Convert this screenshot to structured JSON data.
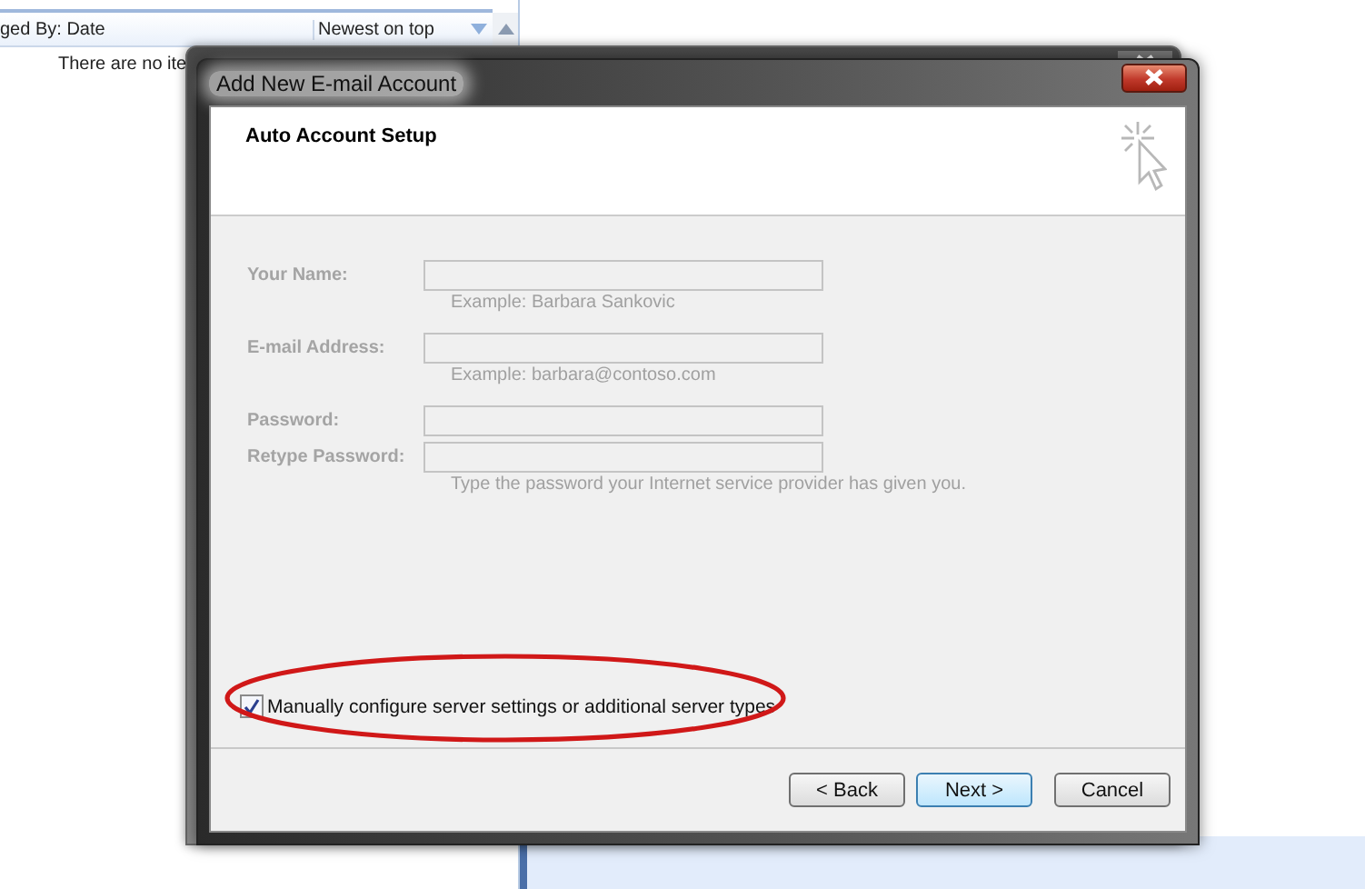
{
  "background_window": {
    "sort_label": "ged By: Date",
    "sort_order": "Newest on top",
    "empty_message": "There are no ite"
  },
  "dialog": {
    "title": "Add New E-mail Account",
    "heading": "Auto Account Setup",
    "fields": [
      {
        "label": "Your Name:",
        "hint": "Example: Barbara Sankovic",
        "disabled": true
      },
      {
        "label": "E-mail Address:",
        "hint": "Example: barbara@contoso.com",
        "disabled": true
      },
      {
        "label": "Password:",
        "disabled": true
      },
      {
        "label": "Retype Password:",
        "hint": "Type the password your Internet service provider has given you.",
        "disabled": true
      }
    ],
    "manual_setup": {
      "label": "Manually configure server settings or additional server types",
      "checked": true
    },
    "buttons": [
      {
        "label": "< Back",
        "default": false
      },
      {
        "label": "Next >",
        "default": true
      },
      {
        "label": "Cancel",
        "default": false
      }
    ]
  }
}
